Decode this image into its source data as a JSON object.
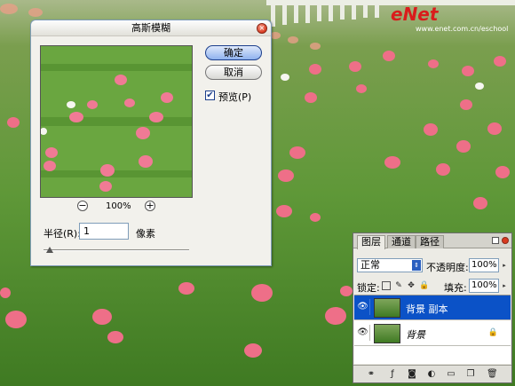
{
  "watermark": {
    "brand": "eNet",
    "sub": "www.enet.com.cn/eschool"
  },
  "dialog": {
    "title": "高斯模糊",
    "ok_label": "确定",
    "cancel_label": "取消",
    "preview_label": "预览(P)",
    "preview_checked": true,
    "zoom_minus": "−",
    "zoom_plus": "+",
    "zoom_level": "100%",
    "radius_label": "半径(R):",
    "radius_value": "1",
    "radius_unit": "像素",
    "radius_slider_fraction": 0.02
  },
  "layers_panel": {
    "tabs": [
      "图层",
      "通道",
      "路径"
    ],
    "active_tab": 0,
    "blend_mode": "正常",
    "opacity_label": "不透明度:",
    "opacity_value": "100%",
    "lock_label": "锁定:",
    "fill_label": "填充:",
    "fill_value": "100%",
    "layers": [
      {
        "name": "背景 副本",
        "selected": true,
        "locked": false
      },
      {
        "name": "背景",
        "selected": false,
        "locked": true
      }
    ],
    "bottom_icons": [
      "link-icon",
      "layer-style-icon",
      "mask-icon",
      "adjustment-icon",
      "group-icon",
      "new-layer-icon",
      "trash-icon"
    ]
  },
  "colors": {
    "selection": "#0b52c7",
    "close_button": "#d9391f",
    "watermark": "#d91c1c"
  }
}
